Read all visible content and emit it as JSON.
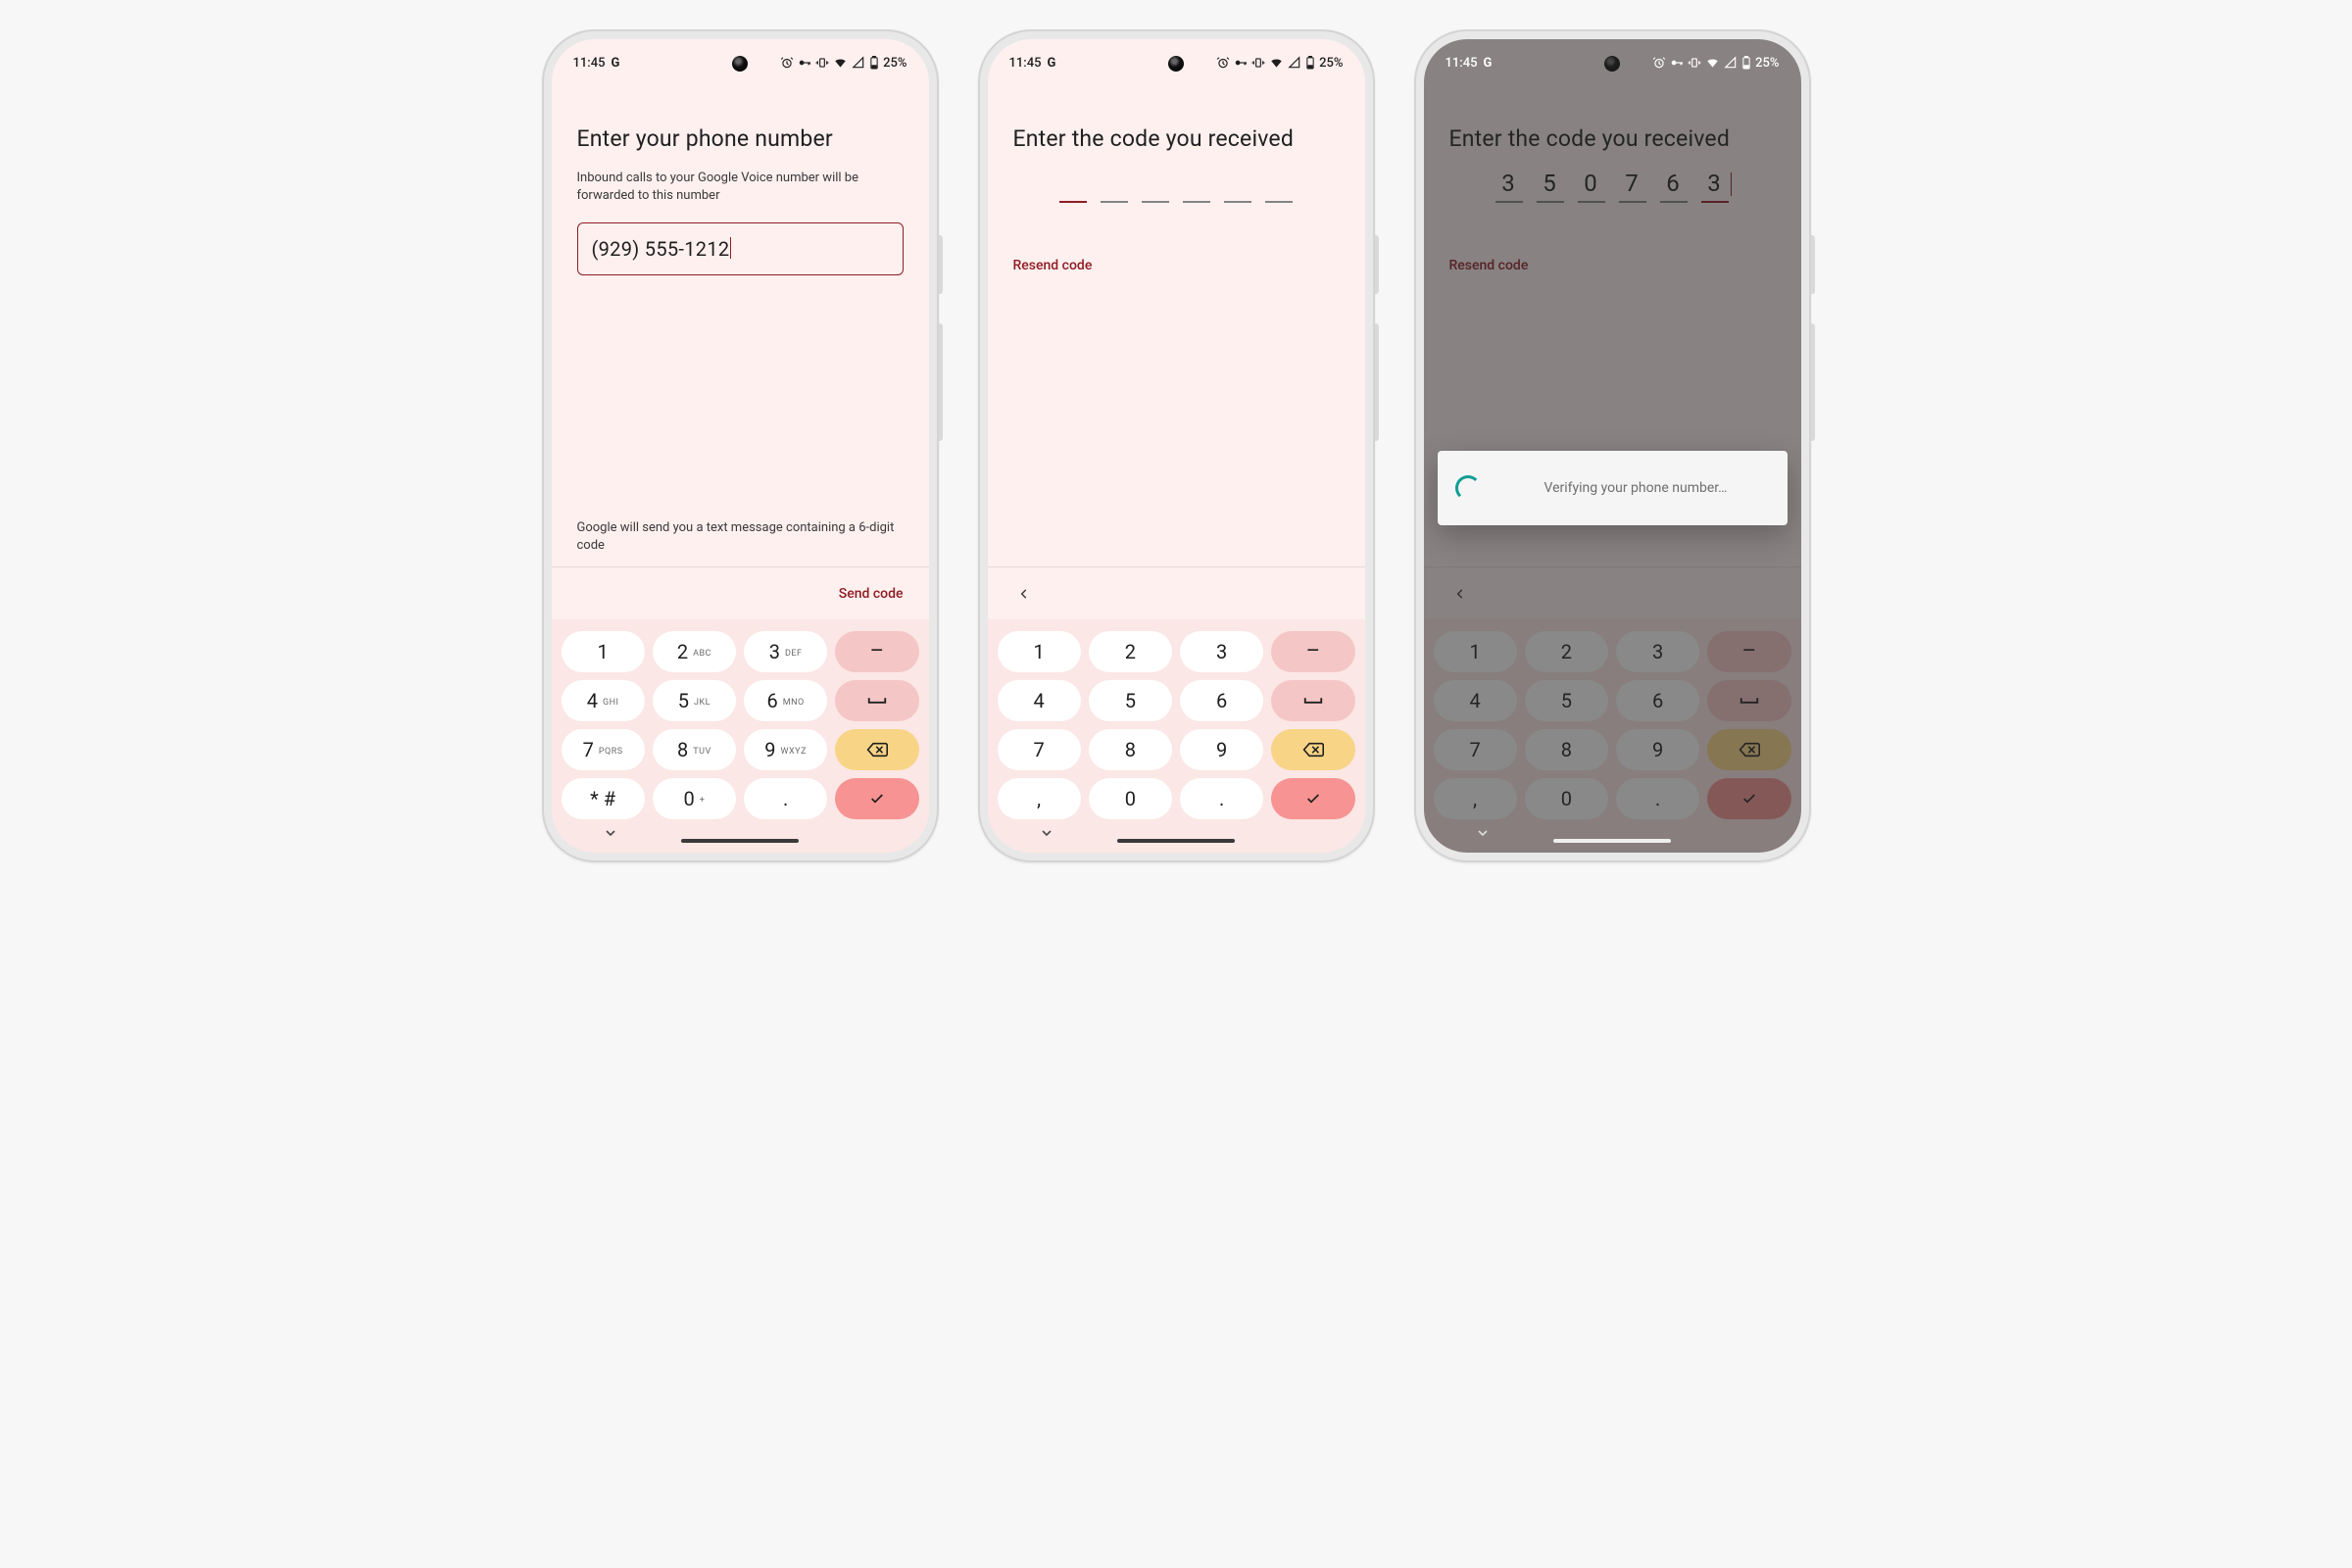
{
  "status_bar": {
    "time": "11:45",
    "google_indicator": "G",
    "battery_text": "25%",
    "icons": [
      "alarm",
      "vpn-key",
      "vibrate",
      "wifi",
      "cell-signal",
      "battery-low"
    ]
  },
  "screen1": {
    "title": "Enter your phone number",
    "subtitle": "Inbound calls to your Google Voice number will be forwarded to this number",
    "phone_value": "(929) 555-1212",
    "info": "Google will send you a text message containing a 6-digit code",
    "primary_action": "Send code"
  },
  "screen2": {
    "title": "Enter the code you received",
    "code": [
      "",
      "",
      "",
      "",
      "",
      ""
    ],
    "active_index": 0,
    "resend_label": "Resend code"
  },
  "screen3": {
    "title": "Enter the code you received",
    "code": [
      "3",
      "5",
      "0",
      "7",
      "6",
      "3"
    ],
    "active_index": 5,
    "resend_label": "Resend code",
    "dialog_text": "Verifying your phone number…"
  },
  "keypad_variants": {
    "alpha": {
      "keys": [
        {
          "main": "1",
          "sub": ""
        },
        {
          "main": "2",
          "sub": "ABC"
        },
        {
          "main": "3",
          "sub": "DEF"
        },
        {
          "type": "dash"
        },
        {
          "main": "4",
          "sub": "GHI"
        },
        {
          "main": "5",
          "sub": "JKL"
        },
        {
          "main": "6",
          "sub": "MNO"
        },
        {
          "type": "space"
        },
        {
          "main": "7",
          "sub": "PQRS"
        },
        {
          "main": "8",
          "sub": "TUV"
        },
        {
          "main": "9",
          "sub": "WXYZ"
        },
        {
          "type": "backspace"
        },
        {
          "main": "* #",
          "sub": ""
        },
        {
          "main": "0",
          "sub": "+"
        },
        {
          "main": ".",
          "sub": ""
        },
        {
          "type": "submit"
        }
      ]
    },
    "plain": {
      "keys": [
        {
          "main": "1"
        },
        {
          "main": "2"
        },
        {
          "main": "3"
        },
        {
          "type": "dash"
        },
        {
          "main": "4"
        },
        {
          "main": "5"
        },
        {
          "main": "6"
        },
        {
          "type": "space"
        },
        {
          "main": "7"
        },
        {
          "main": "8"
        },
        {
          "main": "9"
        },
        {
          "type": "backspace"
        },
        {
          "main": ","
        },
        {
          "main": "0"
        },
        {
          "main": "."
        },
        {
          "type": "submit"
        }
      ]
    }
  }
}
